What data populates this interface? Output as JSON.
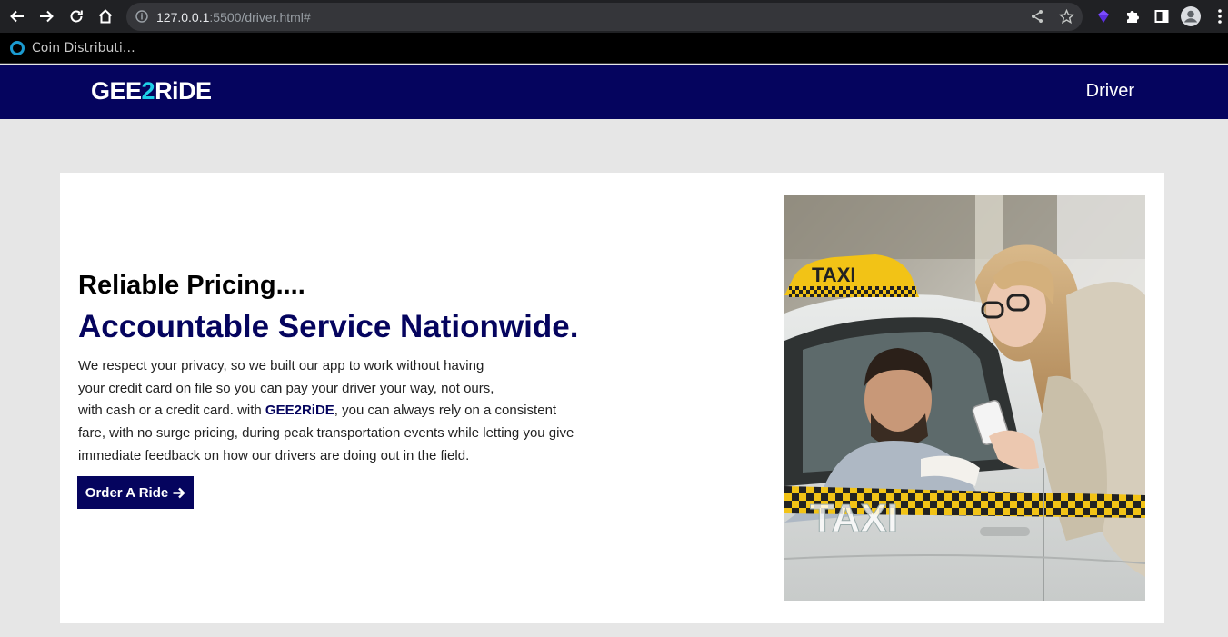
{
  "browser": {
    "url_host": "127.0.0.1",
    "url_rest": ":5500/driver.html#",
    "bookmark_label": "Coin Distributi…"
  },
  "header": {
    "logo_part1": "GEE",
    "logo_accent": "2",
    "logo_part2": "RiDE",
    "nav_driver": "Driver",
    "bg_color": "#05045e",
    "accent_color": "#1ed0e8"
  },
  "hero": {
    "headline": "Reliable Pricing....",
    "subheadline": "Accountable Service Nationwide.",
    "paragraph": {
      "line1": "We respect your privacy, so we built our app to work without having",
      "line2": "your credit card on file so you can pay your driver your way, not ours,",
      "line3_before": "with cash or a credit card. with ",
      "line3_brand": "GEE2RiDE",
      "line3_after": ", you can always rely on a consistent",
      "line4": "fare, with no surge pricing, during peak transportation events while letting you give",
      "line5": "immediate feedback on how our drivers are doing out in the field."
    },
    "cta_label": "Order A Ride",
    "cta_icon": "arrow-right-icon",
    "image_sign_text": "TAXI",
    "image_door_text": "TAXI"
  }
}
